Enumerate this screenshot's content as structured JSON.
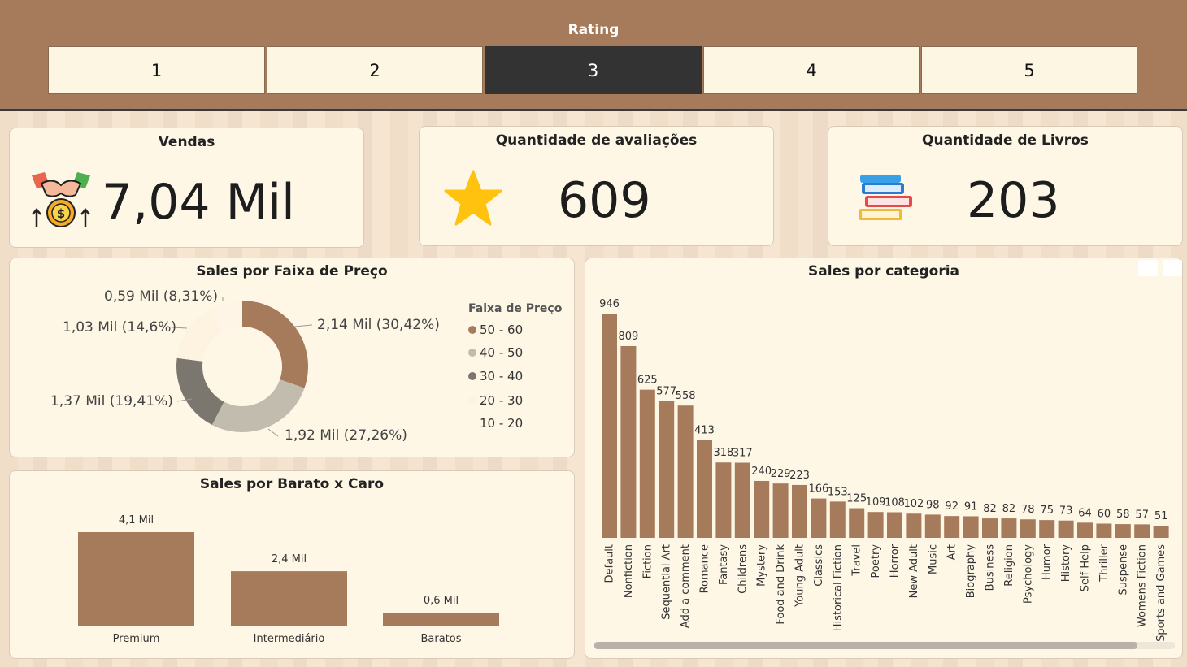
{
  "header": {
    "title": "Rating",
    "options": [
      "1",
      "2",
      "3",
      "4",
      "5"
    ],
    "selected_index": 2
  },
  "kpis": {
    "sales": {
      "title": "Vendas",
      "value": "7,04 Mil",
      "icon": "handshake-money-icon"
    },
    "reviews": {
      "title": "Quantidade de avaliações",
      "value": "609",
      "icon": "star-icon"
    },
    "books": {
      "title": "Quantidade de Livros",
      "value": "203",
      "icon": "books-stack-icon"
    }
  },
  "price_range_chart": {
    "title": "Sales por Faixa de Preço",
    "legend_title": "Faixa de Preço",
    "labels": {
      "l1": "0,59 Mil (8,31%)",
      "l2": "1,03 Mil (14,6%)",
      "l3": "2,14 Mil (30,42%)",
      "l4": "1,37 Mil (19,41%)",
      "l5": "1,92 Mil (27,26%)"
    },
    "legend": [
      "50 - 60",
      "40 - 50",
      "30 - 40",
      "20 - 30",
      "10 - 20"
    ]
  },
  "cheap_expensive_chart": {
    "title": "Sales por Barato x Caro"
  },
  "category_chart": {
    "title": "Sales por categoria"
  },
  "colors": {
    "brown": "#a67b5b",
    "light_gray": "#c2bcaf",
    "dark_gray": "#7b776f",
    "cream": "#fef7e6",
    "star": "#ffc20e"
  },
  "chart_data": [
    {
      "type": "pie",
      "title": "Sales por Faixa de Preço",
      "categories": [
        "50 - 60",
        "40 - 50",
        "30 - 40",
        "20 - 30",
        "10 - 20"
      ],
      "values": [
        2.14,
        1.92,
        1.37,
        1.03,
        0.59
      ],
      "percent": [
        30.42,
        27.26,
        19.41,
        14.6,
        8.31
      ],
      "unit": "Mil",
      "legend_position": "right"
    },
    {
      "type": "bar",
      "title": "Sales por Barato x Caro",
      "categories": [
        "Premium",
        "Intermediário",
        "Baratos"
      ],
      "values": [
        4.1,
        2.4,
        0.6
      ],
      "value_labels": [
        "4,1 Mil",
        "2,4 Mil",
        "0,6 Mil"
      ]
    },
    {
      "type": "bar",
      "title": "Sales por categoria",
      "categories": [
        "Default",
        "Nonfiction",
        "Fiction",
        "Sequential Art",
        "Add a comment",
        "Romance",
        "Fantasy",
        "Childrens",
        "Mystery",
        "Food and Drink",
        "Young Adult",
        "Classics",
        "Historical Fiction",
        "Travel",
        "Poetry",
        "Horror",
        "New Adult",
        "Music",
        "Art",
        "Biography",
        "Business",
        "Religion",
        "Psychology",
        "Humor",
        "History",
        "Self Help",
        "Thriller",
        "Suspense",
        "Womens Fiction",
        "Sports and Games"
      ],
      "values": [
        946,
        809,
        625,
        577,
        558,
        413,
        318,
        317,
        240,
        229,
        223,
        166,
        153,
        125,
        109,
        108,
        102,
        98,
        92,
        91,
        82,
        82,
        78,
        75,
        73,
        64,
        60,
        58,
        57,
        51
      ]
    }
  ]
}
